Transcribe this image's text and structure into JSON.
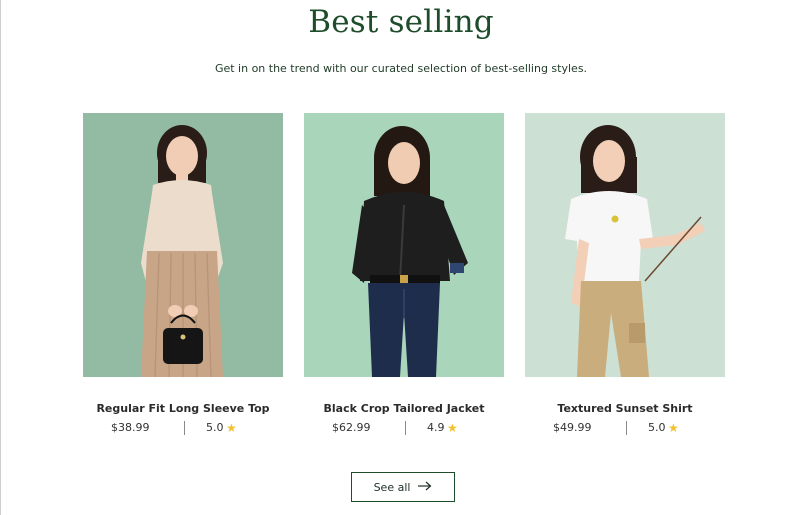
{
  "section": {
    "title": "Best selling",
    "subtitle": "Get in on the trend with our curated selection of best-selling styles."
  },
  "products": [
    {
      "name": "Regular Fit Long Sleeve Top",
      "price": "$38.99",
      "rating": "5.0",
      "bg_color": "#93bba3",
      "icon": "star-icon"
    },
    {
      "name": "Black Crop Tailored Jacket",
      "price": "$62.99",
      "rating": "4.9",
      "bg_color": "#a9d5bb",
      "icon": "star-icon"
    },
    {
      "name": "Textured Sunset Shirt",
      "price": "$49.99",
      "rating": "5.0",
      "bg_color": "#cde0d4",
      "icon": "star-icon"
    }
  ],
  "see_all": {
    "label": "See all",
    "icon": "arrow-right-icon"
  },
  "colors": {
    "brand_green": "#1f4d2c",
    "star": "#f2c230"
  }
}
